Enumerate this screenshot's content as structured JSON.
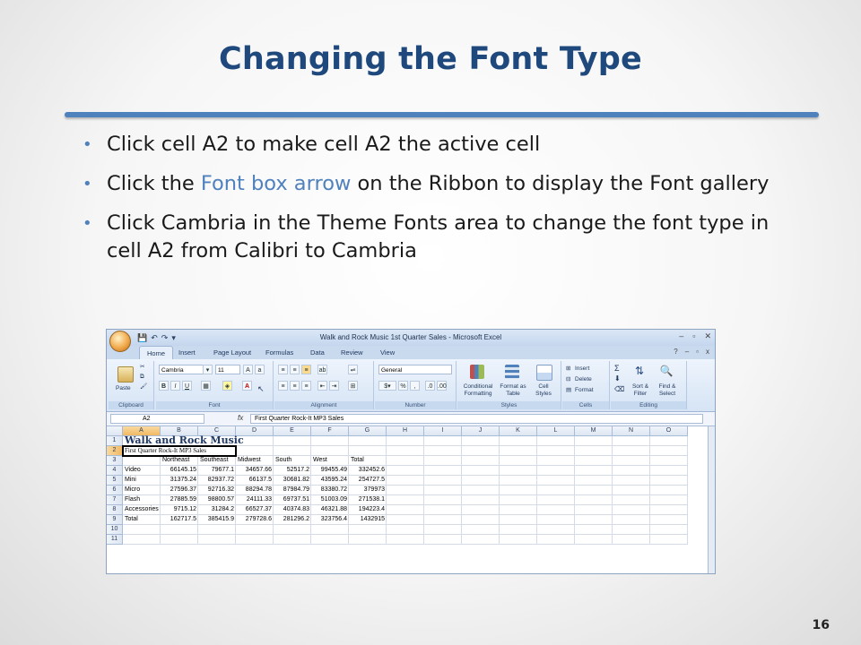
{
  "slide": {
    "title": "Changing the Font Type",
    "bullets": [
      {
        "pre": "Click cell A2 to make cell A2 the active cell",
        "hl": "",
        "post": ""
      },
      {
        "pre": "Click the ",
        "hl": "Font box arrow",
        "post": " on the Ribbon to display the Font gallery"
      },
      {
        "pre": "Click Cambria in the Theme Fonts area to change the font type in cell A2 from Calibri to Cambria",
        "hl": "",
        "post": ""
      }
    ],
    "page_number": "16",
    "accent_color": "#4f81bd",
    "title_color": "#1f497d"
  },
  "excel": {
    "window_title": "Walk and Rock Music 1st Quarter Sales - Microsoft Excel",
    "tabs": [
      "Home",
      "Insert",
      "Page Layout",
      "Formulas",
      "Data",
      "Review",
      "View"
    ],
    "active_tab": "Home",
    "ribbon": {
      "clipboard": {
        "label": "Clipboard",
        "paste": "Paste"
      },
      "font": {
        "label": "Font",
        "font_name": "Cambria",
        "font_size": "11"
      },
      "alignment": {
        "label": "Alignment"
      },
      "number": {
        "label": "Number",
        "format": "General"
      },
      "styles": {
        "label": "Styles",
        "conditional": "Conditional Formatting",
        "format_table": "Format as Table",
        "cell_styles": "Cell Styles"
      },
      "cells": {
        "label": "Cells",
        "insert": "Insert",
        "delete": "Delete",
        "format": "Format"
      },
      "editing": {
        "label": "Editing",
        "sort": "Sort & Filter",
        "find": "Find & Select"
      }
    },
    "name_box": "A2",
    "formula": "First Quarter Rock-It MP3 Sales",
    "columns": [
      "A",
      "B",
      "C",
      "D",
      "E",
      "F",
      "G",
      "H",
      "I",
      "J",
      "K",
      "L",
      "M",
      "N",
      "O"
    ],
    "rows": [
      [
        "Walk and Rock Music",
        "",
        "",
        "",
        "",
        "",
        ""
      ],
      [
        "First Quarter Rock-It MP3 Sales",
        "",
        "",
        "",
        "",
        "",
        ""
      ],
      [
        "",
        "Northeast",
        "Southeast",
        "Midwest",
        "South",
        "West",
        "Total"
      ],
      [
        "Video",
        "66145.15",
        "79677.1",
        "34657.66",
        "52517.2",
        "99455.49",
        "332452.6"
      ],
      [
        "Mini",
        "31375.24",
        "82937.72",
        "66137.5",
        "30681.82",
        "43595.24",
        "254727.5"
      ],
      [
        "Micro",
        "27596.37",
        "92716.32",
        "88294.78",
        "87984.79",
        "83380.72",
        "379973"
      ],
      [
        "Flash",
        "27885.59",
        "98800.57",
        "24111.33",
        "69737.51",
        "51003.09",
        "271538.1"
      ],
      [
        "Accessories",
        "9715.12",
        "31284.2",
        "66527.37",
        "40374.83",
        "46321.88",
        "194223.4"
      ],
      [
        "Total",
        "162717.5",
        "385415.9",
        "279728.6",
        "281296.2",
        "323756.4",
        "1432915"
      ],
      [
        "",
        "",
        "",
        "",
        "",
        "",
        ""
      ],
      [
        "",
        "",
        "",
        "",
        "",
        "",
        ""
      ]
    ]
  }
}
